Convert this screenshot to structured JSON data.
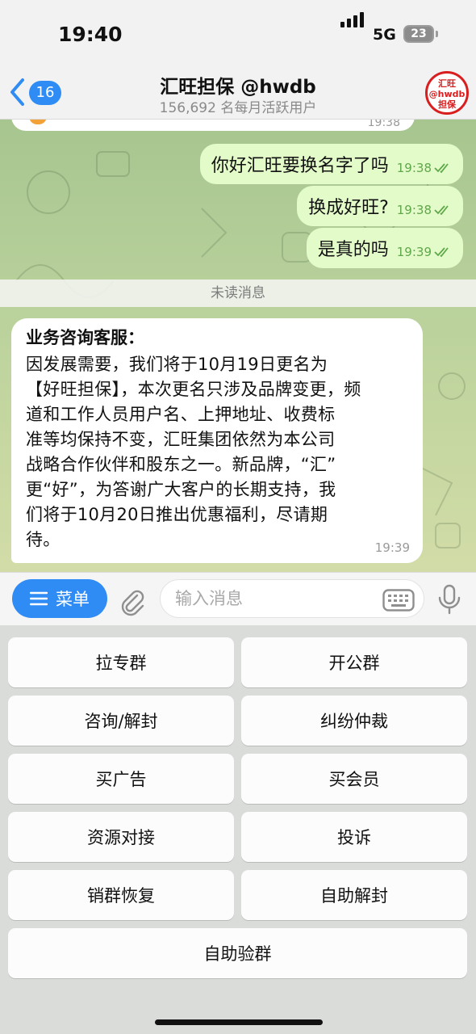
{
  "status_bar": {
    "time": "19:40",
    "network": "5G",
    "battery": "23"
  },
  "header": {
    "back_badge": "16",
    "title": "汇旺担保 @hwdb",
    "subtitle": "156,692 名每月活跃用户",
    "avatar": [
      "汇旺",
      "@hwdb",
      "担保"
    ]
  },
  "chat": {
    "previous_time": "19:38",
    "outgoing": [
      {
        "text": "你好汇旺要换名字了吗",
        "time": "19:38"
      },
      {
        "text": "换成好旺?",
        "time": "19:38"
      },
      {
        "text": "是真的吗",
        "time": "19:39"
      }
    ],
    "unread_divider": "未读消息",
    "incoming": {
      "sender": "业务咨询客服：",
      "text": "因发展需要，我们将于10月19日更名为\n【好旺担保】，本次更名只涉及品牌变更，频\n道和工作人员用户名、上押地址、收费标\n准等均保持不变，汇旺集团依然为本公司\n战略合作伙伴和股东之一。新品牌，“汇”\n更“好”，为答谢广大客户的长期支持，我\n们将于10月20日推出优惠福利，尽请期\n待。",
      "time": "19:39"
    }
  },
  "input_bar": {
    "menu_label": "菜单",
    "placeholder": "输入消息"
  },
  "keyboard": {
    "rows": [
      [
        "拉专群",
        "开公群"
      ],
      [
        "咨询/解封",
        "纠纷仲裁"
      ],
      [
        "买广告",
        "买会员"
      ],
      [
        "资源对接",
        "投诉"
      ],
      [
        "销群恢复",
        "自助解封"
      ],
      [
        "自助验群"
      ]
    ]
  },
  "colors": {
    "accent": "#2f8cf4",
    "outgoing_bubble": "#e3fbc9",
    "incoming_bubble": "#ffffff",
    "check": "#5fa84a"
  }
}
